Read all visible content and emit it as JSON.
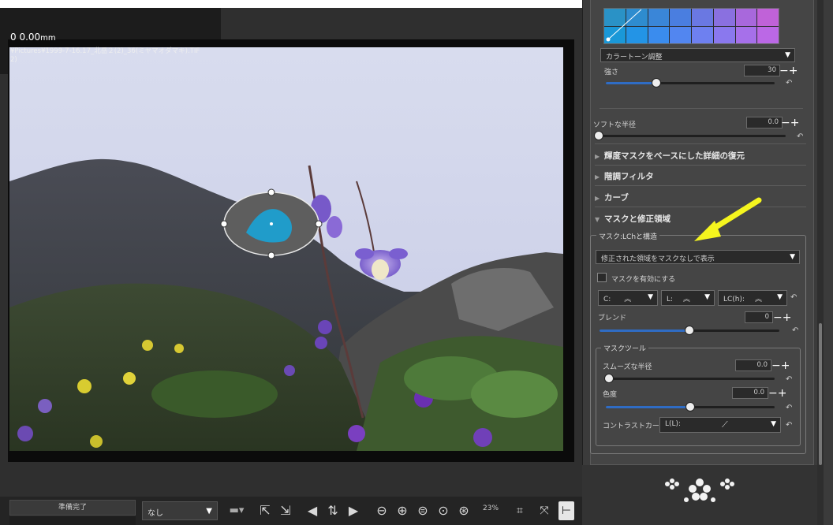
{
  "viewer": {
    "zoom_readout": "0  0.00",
    "zoom_unit": "mm",
    "file_path_line1": "¥Pictures¥1999-7-16.17_北岳２(2)_36(ミヤマオダマキ).TIF",
    "file_path_line2": "2)"
  },
  "bottombar": {
    "status": "準備完了",
    "mode_select": "なし",
    "zoom_percent": "23%"
  },
  "panel": {
    "color_tone_select": "カラートーン調整",
    "strength_label": "強さ",
    "strength_value": "30",
    "strength_fraction": 0.3,
    "soft_radius_label": "ソフトな半径",
    "soft_radius_value": "0.0",
    "sections": [
      {
        "label": "輝度マスクをベースにした詳細の復元",
        "expanded": false
      },
      {
        "label": "階調フィルタ",
        "expanded": false
      },
      {
        "label": "カーブ",
        "expanded": false
      },
      {
        "label": "マスクと修正領域",
        "expanded": true
      }
    ],
    "mask_group": {
      "title": "マスク:LChと構造",
      "display_select": "修正された領域をマスクなしで表示",
      "enable_mask_label": "マスクを有効にする",
      "enable_mask_checked": false,
      "curve_c_label": "C:",
      "curve_l_label": "L:",
      "curve_lch_label": "LC(h):",
      "blend_label": "ブレンド",
      "blend_value": "0",
      "blend_fraction": 0.5
    },
    "mask_tools": {
      "title": "マスクツール",
      "smooth_radius_label": "スムーズな半径",
      "smooth_radius_value": "0.0",
      "saturation_label": "色度",
      "saturation_value": "0.0",
      "saturation_fraction": 0.5,
      "contrast_curve_label": "コントラストカーブ:",
      "contrast_curve_select": "L(L):"
    }
  },
  "colors": {
    "accent_blue": "#2f6cc4",
    "annotation_arrow": "#f5f51e",
    "mask_overlay": "#1aa3d6"
  }
}
